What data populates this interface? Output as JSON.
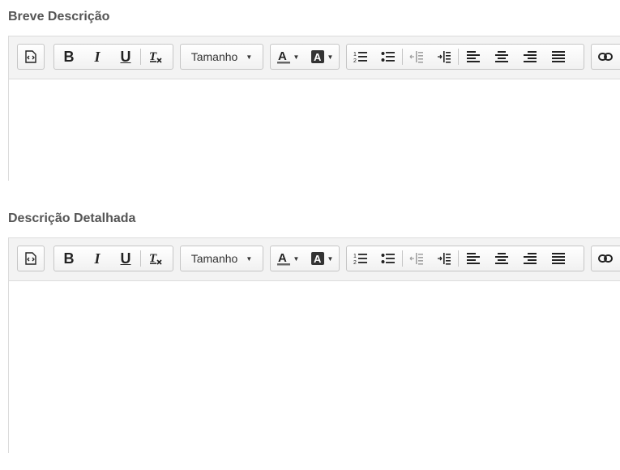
{
  "fields": [
    {
      "label": "Breve Descrição"
    },
    {
      "label": "Descrição Detalhada"
    }
  ],
  "toolbar": {
    "size_label": "Tamanho",
    "icons": {
      "source": "source-code-icon",
      "bold": "B",
      "italic": "I",
      "underline": "U",
      "remove_format": "clear-format-icon"
    },
    "colors": {
      "text_color_bar": "#666666",
      "bg_color_box": "#333333"
    }
  }
}
